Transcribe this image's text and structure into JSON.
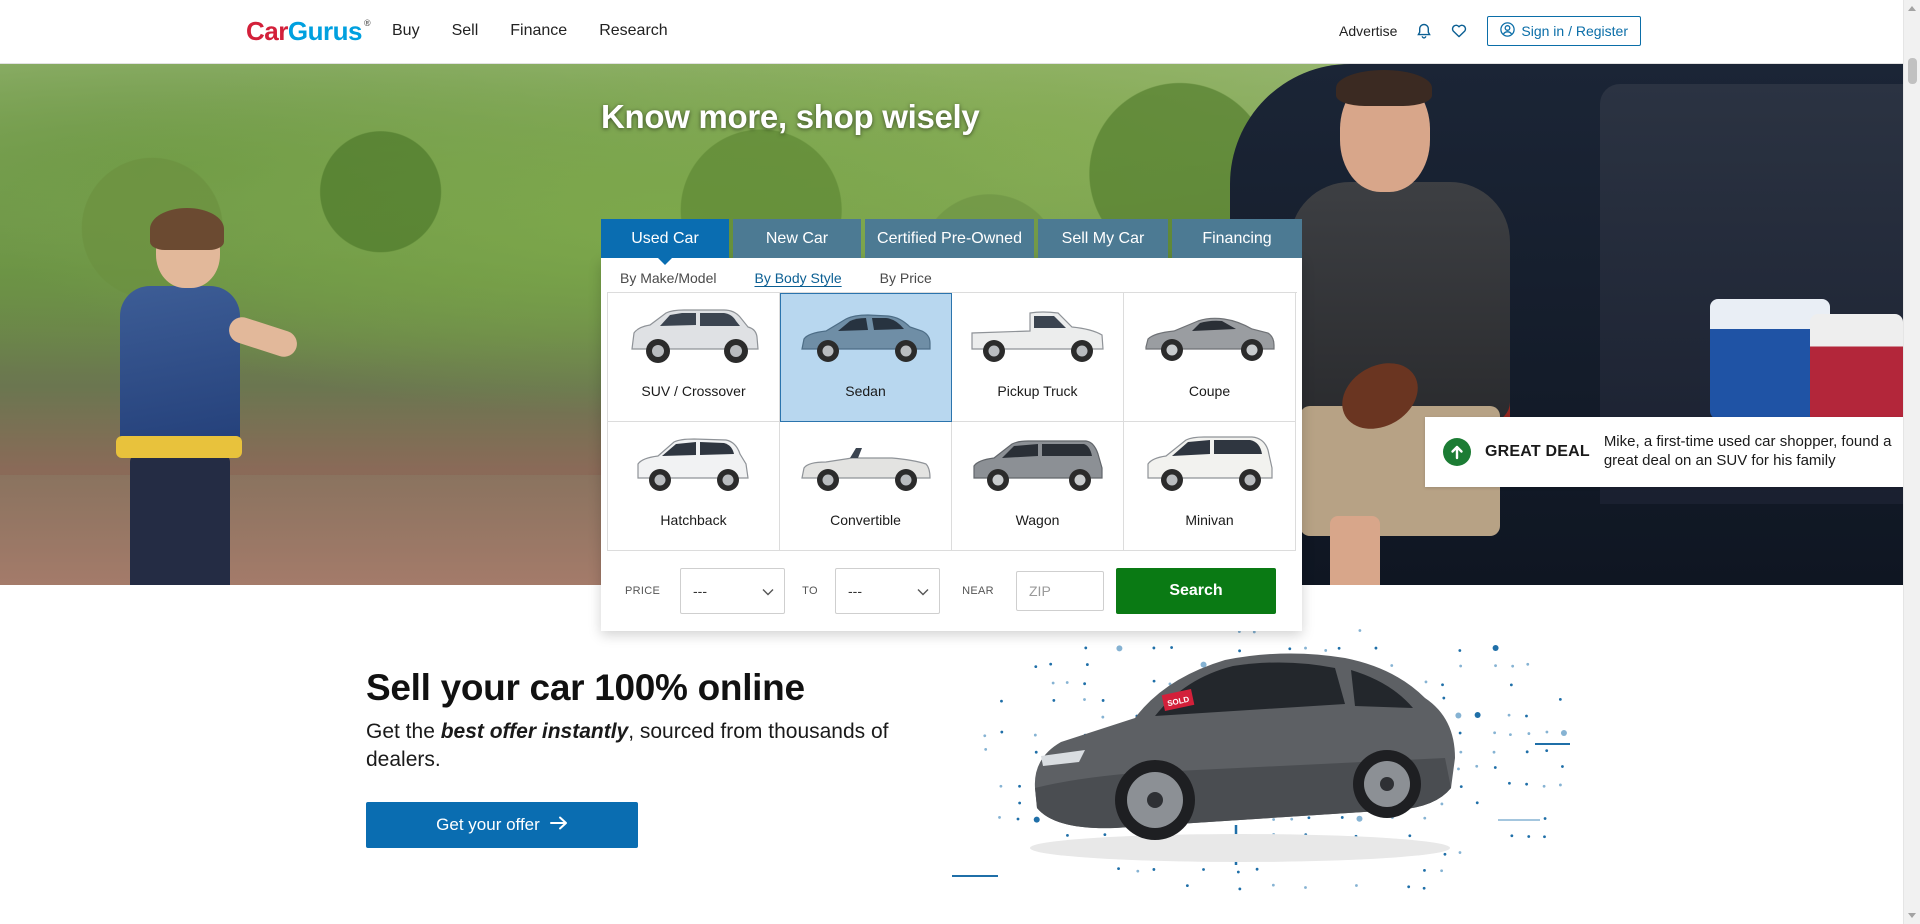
{
  "header": {
    "logo": {
      "part1": "Car",
      "part2": "Gurus",
      "reg": "®"
    },
    "nav": [
      "Buy",
      "Sell",
      "Finance",
      "Research"
    ],
    "advertise": "Advertise",
    "signin": "Sign in / Register"
  },
  "hero": {
    "title": "Know more, shop wisely",
    "great_deal": {
      "label": "GREAT DEAL",
      "text": "Mike, a first-time used car shopper, found a great deal on an SUV for his family"
    }
  },
  "widget": {
    "tabs": [
      "Used Car",
      "New Car",
      "Certified Pre-Owned",
      "Sell My Car",
      "Financing"
    ],
    "active_tab": "Used Car",
    "subtabs": [
      "By Make/Model",
      "By Body Style",
      "By Price"
    ],
    "active_subtab": "By Body Style",
    "body_styles": [
      "SUV / Crossover",
      "Sedan",
      "Pickup Truck",
      "Coupe",
      "Hatchback",
      "Convertible",
      "Wagon",
      "Minivan"
    ],
    "selected_body_style": "Sedan",
    "filters": {
      "price_label": "PRICE",
      "price_from": "---",
      "to_label": "TO",
      "price_to": "---",
      "near_label": "NEAR",
      "zip_placeholder": "ZIP",
      "search_label": "Search"
    }
  },
  "sell": {
    "title": "Sell your car 100% online",
    "sub_pre": "Get the ",
    "sub_em": "best offer instantly",
    "sub_post": ", sourced from thousands of dealers.",
    "button": "Get your offer",
    "sticker": "SOLD"
  },
  "colors": {
    "accent_blue": "#0a6db1",
    "tab_inactive": "#4c7a93",
    "search_green": "#0a7a14",
    "great_deal_green": "#1c7c34",
    "logo_red": "#d3203a"
  }
}
